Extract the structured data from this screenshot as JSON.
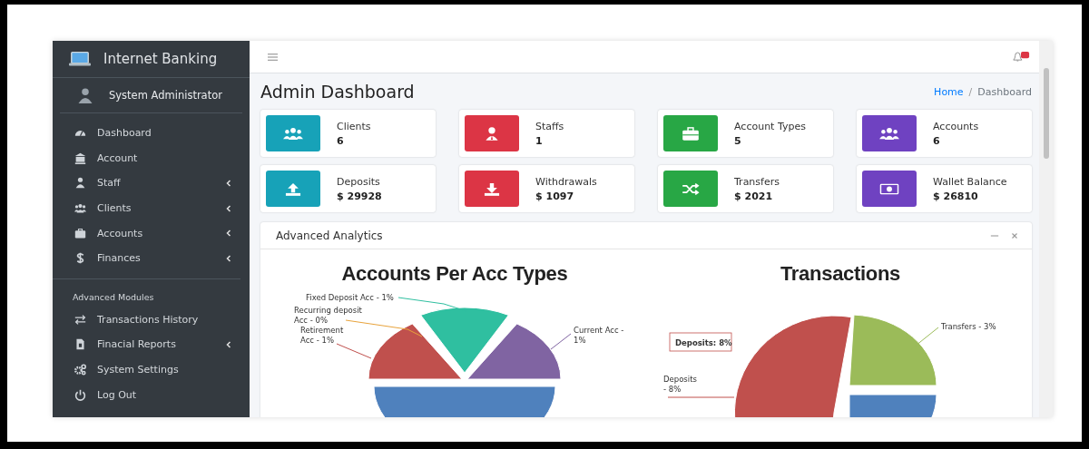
{
  "sidebar": {
    "brand": "Internet Banking",
    "user": "System Administrator",
    "section_heading": "Advanced Modules",
    "items": [
      {
        "label": "Dashboard",
        "has_submenu": false
      },
      {
        "label": "Account",
        "has_submenu": false
      },
      {
        "label": "Staff",
        "has_submenu": true
      },
      {
        "label": "Clients",
        "has_submenu": true
      },
      {
        "label": "Accounts",
        "has_submenu": true
      },
      {
        "label": "Finances",
        "has_submenu": true
      }
    ],
    "module_items": [
      {
        "label": "Transactions History",
        "has_submenu": false
      },
      {
        "label": "Finacial Reports",
        "has_submenu": true
      },
      {
        "label": "System Settings",
        "has_submenu": false
      },
      {
        "label": "Log Out",
        "has_submenu": false
      }
    ]
  },
  "page_title": "Admin Dashboard",
  "breadcrumb": {
    "separator": "/",
    "items": [
      {
        "label": "Home",
        "link": true
      },
      {
        "label": "Dashboard",
        "link": false
      }
    ]
  },
  "cards": [
    {
      "color": "#17a2b8",
      "label": "Clients",
      "value": "6"
    },
    {
      "color": "#dc3545",
      "label": "Staffs",
      "value": "1"
    },
    {
      "color": "#28a745",
      "label": "Account Types",
      "value": "5"
    },
    {
      "color": "#6f42c1",
      "label": "Accounts",
      "value": "6"
    },
    {
      "color": "#17a2b8",
      "label": "Deposits",
      "value": "$ 29928"
    },
    {
      "color": "#dc3545",
      "label": "Withdrawals",
      "value": "$ 1097"
    },
    {
      "color": "#28a745",
      "label": "Transfers",
      "value": "$ 2021"
    },
    {
      "color": "#6f42c1",
      "label": "Wallet Balance",
      "value": "$ 26810"
    }
  ],
  "analytics": {
    "title": "Advanced Analytics",
    "charts": [
      {
        "title": "Accounts Per Acc Types",
        "slices": [
          {
            "color": "#2fbfa0",
            "label": [
              "Fixed Deposit Acc - 1%"
            ]
          },
          {
            "color": "#e8a33c",
            "label": [
              "Recurring deposit",
              "Acc  - 0%"
            ]
          },
          {
            "color": "#c0504d",
            "label": [
              "Retirement",
              "Acc - 1%"
            ]
          },
          {
            "color": "#8064a2",
            "label": [
              "Current Acc -",
              "1%"
            ]
          },
          {
            "color": "#4f81bd"
          }
        ]
      },
      {
        "title": "Transactions",
        "tooltip": "Deposits: 8%",
        "slices": [
          {
            "color": "#9bbb59",
            "label": [
              "Transfers - 3%"
            ]
          },
          {
            "color": "#c0504d",
            "label": [
              "Deposits",
              "- 8%"
            ]
          },
          {
            "color": "#4f81bd"
          }
        ]
      }
    ]
  }
}
